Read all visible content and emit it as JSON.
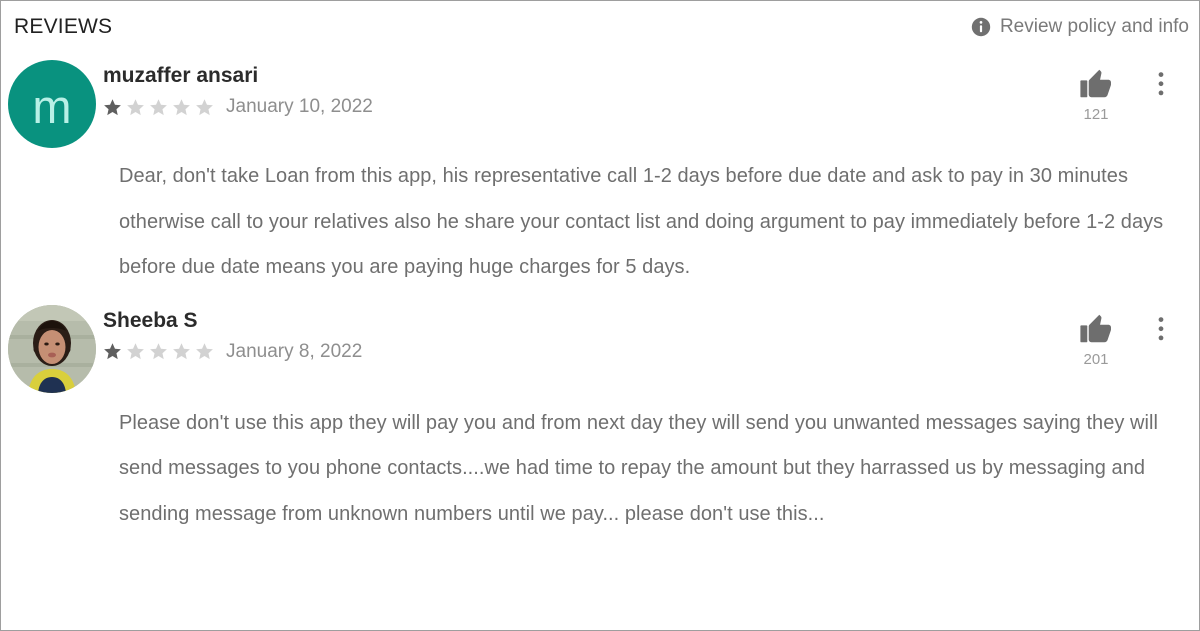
{
  "header": {
    "title": "REVIEWS",
    "policy_label": "Review policy and info",
    "info_icon": "info-icon"
  },
  "icons": {
    "thumbs_up": "thumbs-up-icon",
    "overflow_menu": "more-vert-icon",
    "star_filled": "star-filled-icon",
    "star_empty": "star-empty-icon"
  },
  "colors": {
    "avatar_teal": "#09927f",
    "avatar_letter": "#b8f0e6",
    "star_filled": "#5f5f5f",
    "star_empty": "#d2d2d2",
    "body_text": "#6f6f6f",
    "name_text": "#2b2b2b",
    "muted_text": "#8e8e8e",
    "border": "#9e9e9e"
  },
  "reviews": [
    {
      "author": "muzaffer ansari",
      "avatar_type": "letter",
      "avatar_letter": "m",
      "rating": 1,
      "max_rating": 5,
      "date": "January 10, 2022",
      "helpful_count": "121",
      "text": "Dear, don't take Loan from this app, his representative call 1-2 days before due date and ask to pay in 30 minutes otherwise call to your relatives also he share your contact list and doing argument to pay immediately before 1-2 days before due date means you are paying huge charges for 5 days."
    },
    {
      "author": "Sheeba S",
      "avatar_type": "photo",
      "avatar_letter": "",
      "rating": 1,
      "max_rating": 5,
      "date": "January 8, 2022",
      "helpful_count": "201",
      "text": "Please don't use this app they will pay you and from next day they will send you unwanted messages saying they will send messages to you phone contacts....we had time to repay the amount but they harrassed us by messaging and sending message from unknown numbers until we pay... please don't use this..."
    }
  ]
}
